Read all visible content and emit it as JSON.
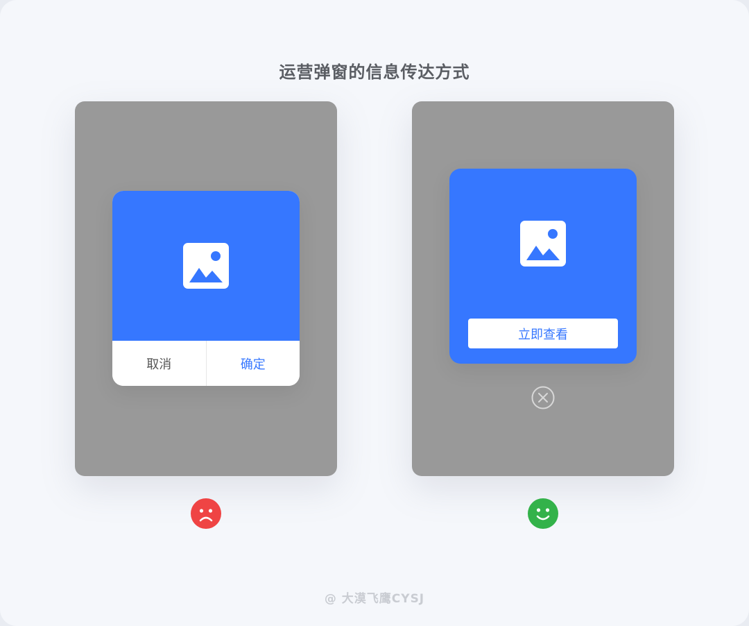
{
  "page": {
    "title": "运营弹窗的信息传达方式",
    "watermark": "@ 大漠飞鹰CYSJ"
  },
  "left_example": {
    "dialog": {
      "image_icon": "image-icon",
      "cancel_label": "取消",
      "confirm_label": "确定"
    },
    "verdict_icon": "sad-face-icon"
  },
  "right_example": {
    "dialog": {
      "image_icon": "image-icon",
      "view_label": "立即查看"
    },
    "close_icon": "close-circle-icon",
    "verdict_icon": "happy-face-icon"
  },
  "colors": {
    "accent": "#3677ff",
    "overlay": "#999999",
    "sad": "#ef4444",
    "happy": "#33b24a"
  }
}
